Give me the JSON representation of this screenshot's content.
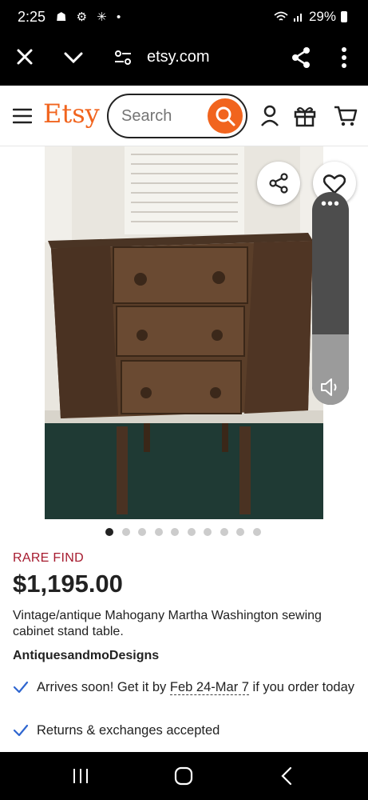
{
  "status_bar": {
    "time": "2:25",
    "left_icons": "☗ ⚙ ✳ •",
    "battery": "29%"
  },
  "browser": {
    "url": "etsy.com",
    "close_icon": "close-icon",
    "menu_icon": "more-vert-icon"
  },
  "header": {
    "logo": "Etsy",
    "search_placeholder": "Search"
  },
  "listing": {
    "badge": "RARE FIND",
    "price": "$1,195.00",
    "title": "Vintage/antique Mahogany Martha Washington sewing cabinet stand table.",
    "shop": "AntiquesandmoDesigns",
    "image_count": 10,
    "active_image": 0,
    "delivery_prefix": "Arrives soon! Get it by ",
    "delivery_dates": "Feb 24-Mar 7",
    "delivery_suffix": " if you order today",
    "returns": "Returns & exchanges accepted"
  },
  "volume": {
    "level": 0.33
  },
  "colors": {
    "brand": "#f1641e",
    "rare_find": "#a61a2e",
    "check": "#2f66d0"
  }
}
